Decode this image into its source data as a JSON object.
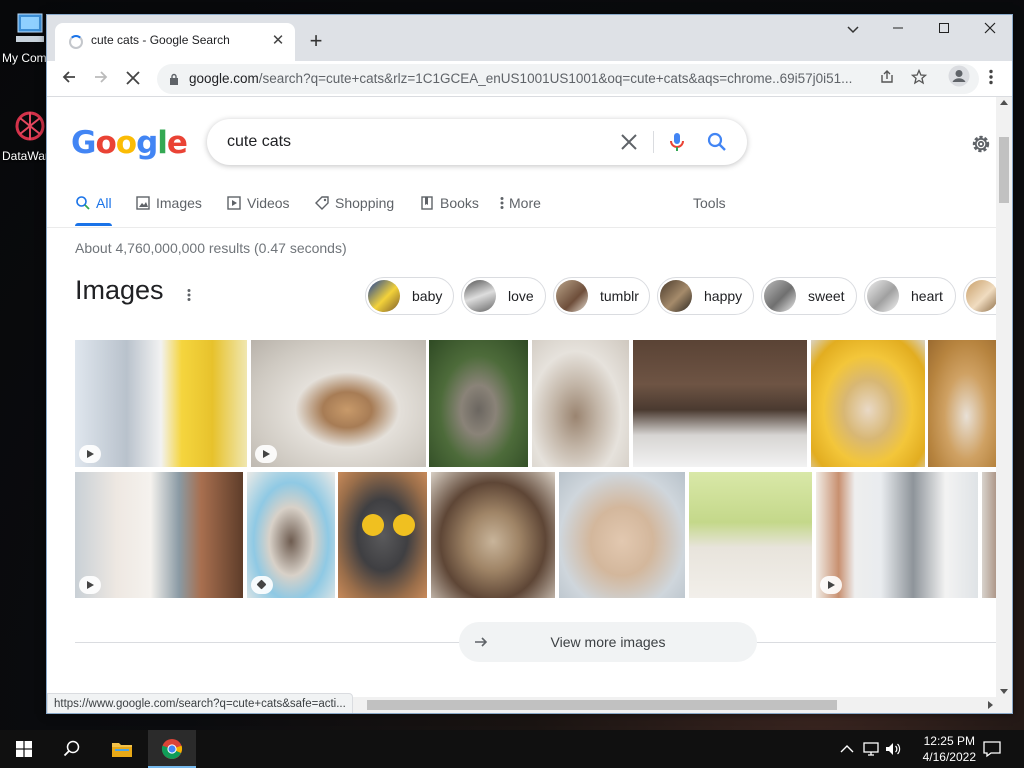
{
  "desktop": {
    "icons": [
      {
        "label": "My Computer",
        "icon": "computer-icon"
      },
      {
        "label": "DataWarrior",
        "icon": "datawarrior-icon"
      }
    ]
  },
  "browser": {
    "tab": {
      "title": "cute cats - Google Search"
    },
    "new_tab": "+",
    "window_controls": {
      "minimize": "—",
      "maximize": "☐",
      "close": "✕",
      "tab_search": "⌄"
    },
    "address": {
      "host": "google.com",
      "path": "/search?q=cute+cats&rlz=1C1GCEA_enUS1001US1001&oq=cute+cats&aqs=chrome..69i57j0i51..."
    },
    "status_url": "https://www.google.com/search?q=cute+cats&safe=acti..."
  },
  "google": {
    "logo": [
      {
        "ch": "G",
        "color": "#4285F4"
      },
      {
        "ch": "o",
        "color": "#EA4335"
      },
      {
        "ch": "o",
        "color": "#FBBC05"
      },
      {
        "ch": "g",
        "color": "#4285F4"
      },
      {
        "ch": "l",
        "color": "#34A853"
      },
      {
        "ch": "e",
        "color": "#EA4335"
      }
    ],
    "query": "cute cats",
    "tabs": [
      {
        "label": "All",
        "icon": "search-icon",
        "active": true
      },
      {
        "label": "Images",
        "icon": "image-icon"
      },
      {
        "label": "Videos",
        "icon": "video-icon"
      },
      {
        "label": "Shopping",
        "icon": "tag-icon"
      },
      {
        "label": "Books",
        "icon": "book-icon"
      },
      {
        "label": "More",
        "icon": "more-vertical-icon"
      }
    ],
    "tools": "Tools",
    "stats": "About 4,760,000,000 results (0.47 seconds)",
    "images_heading": "Images",
    "chips": [
      "baby",
      "love",
      "tumblr",
      "happy",
      "sweet",
      "heart"
    ],
    "view_more": "View more images",
    "accent": "#1a73e8"
  },
  "taskbar": {
    "time": "12:25 PM",
    "date": "4/16/2022",
    "apps": [
      "start-icon",
      "search-icon",
      "file-explorer-icon",
      "chrome-icon"
    ]
  }
}
